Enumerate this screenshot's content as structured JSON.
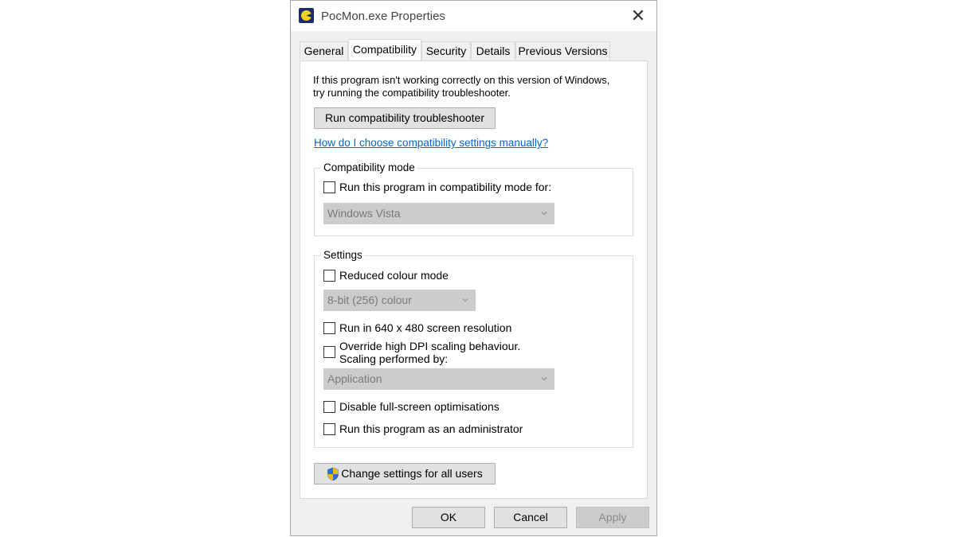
{
  "window": {
    "title": "PocMon.exe Properties"
  },
  "tabs": [
    {
      "label": "General"
    },
    {
      "label": "Compatibility",
      "active": true
    },
    {
      "label": "Security"
    },
    {
      "label": "Details"
    },
    {
      "label": "Previous Versions"
    }
  ],
  "compat": {
    "intro_line1": "If this program isn't working correctly on this version of Windows,",
    "intro_line2": "try running the compatibility troubleshooter.",
    "troubleshooter_button": "Run compatibility troubleshooter",
    "help_link": "How do I choose compatibility settings manually?",
    "mode_group_label": "Compatibility mode",
    "mode_checkbox_label": "Run this program in compatibility mode for:",
    "mode_checked": false,
    "mode_select_value": "Windows Vista"
  },
  "settings": {
    "group_label": "Settings",
    "reduced_colour_label": "Reduced colour mode",
    "reduced_colour_checked": false,
    "colour_select_value": "8-bit (256) colour",
    "resolution_label": "Run in 640 x 480 screen resolution",
    "resolution_checked": false,
    "dpi_label_line1": "Override high DPI scaling behaviour.",
    "dpi_label_line2": "Scaling performed by:",
    "dpi_checked": false,
    "dpi_select_value": "Application",
    "fullscreen_label": "Disable full-screen optimisations",
    "fullscreen_checked": false,
    "admin_label": "Run this program as an administrator",
    "admin_checked": false
  },
  "all_users_button": "Change settings for all users",
  "footer": {
    "ok": "OK",
    "cancel": "Cancel",
    "apply": "Apply"
  },
  "colors": {
    "link": "#0066cc",
    "dialog_bg": "#f0f0f0",
    "disabled_select_bg": "#cccccc"
  }
}
